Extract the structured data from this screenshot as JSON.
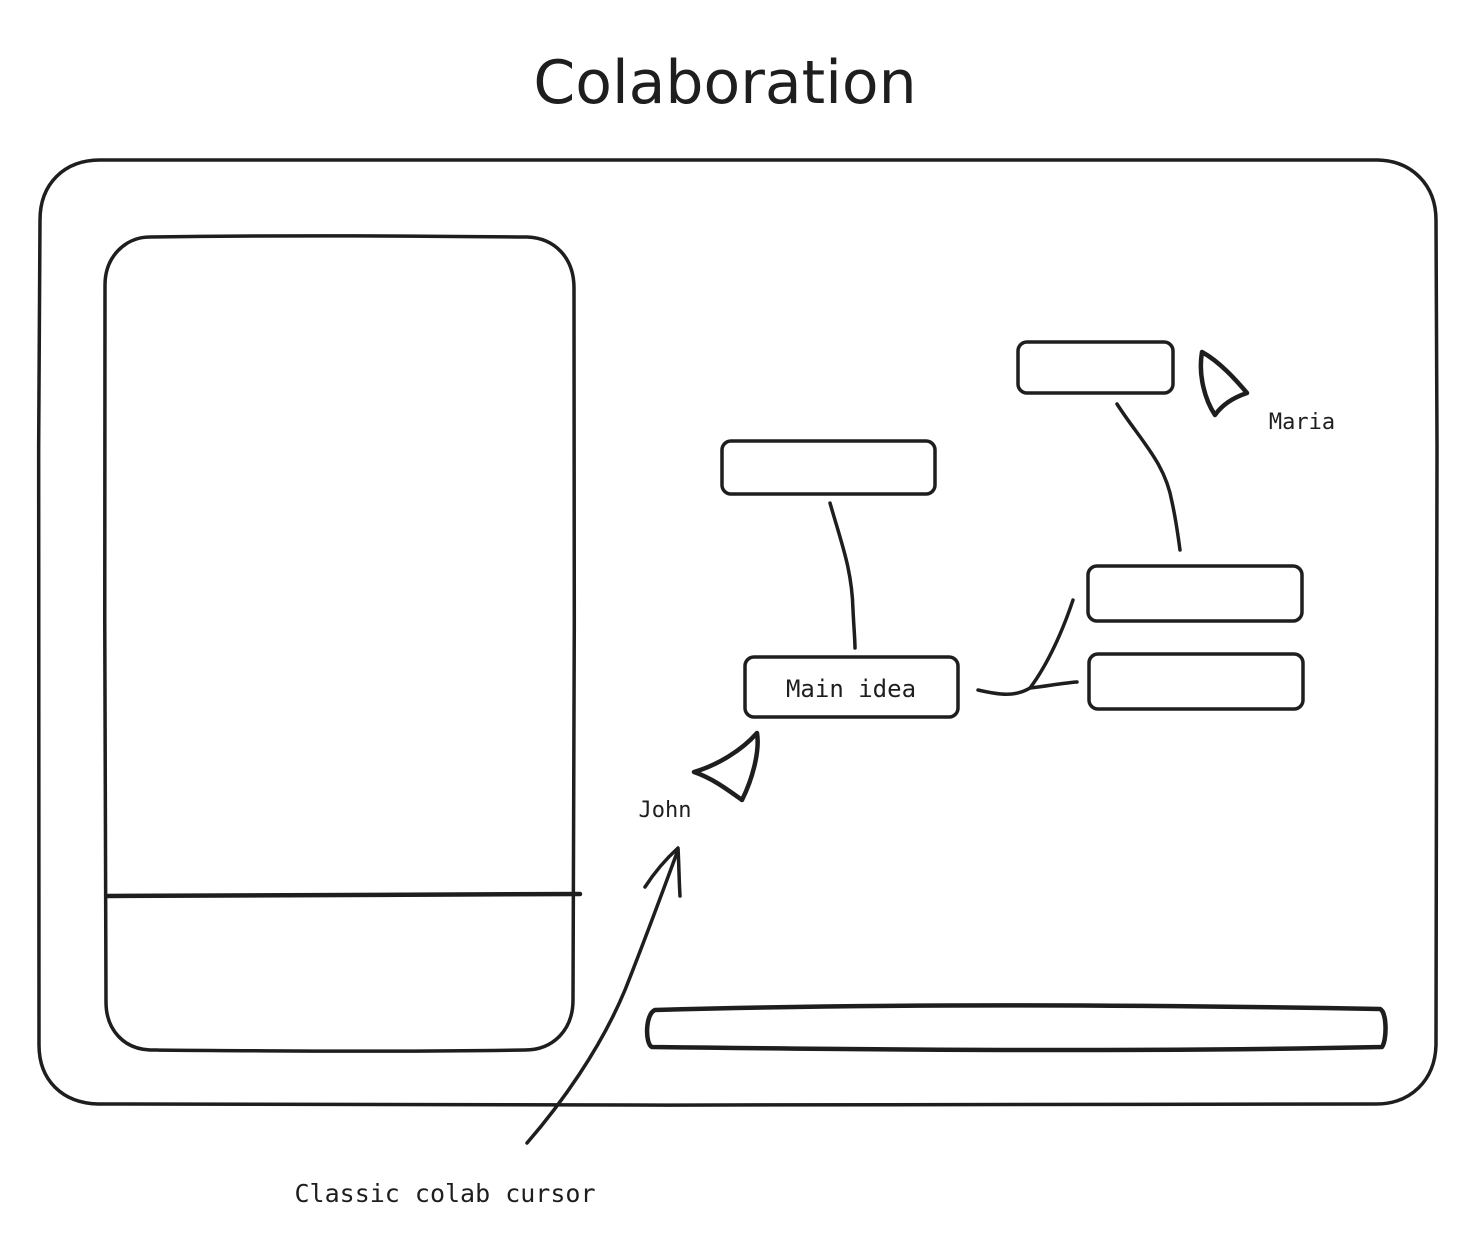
{
  "title": "Colaboration",
  "nodes": {
    "main": "Main idea"
  },
  "cursors": {
    "john": "John",
    "maria": "Maria"
  },
  "annotation": "Classic colab cursor",
  "colors": {
    "stroke": "#1e1e1e",
    "background": "#ffffff"
  }
}
